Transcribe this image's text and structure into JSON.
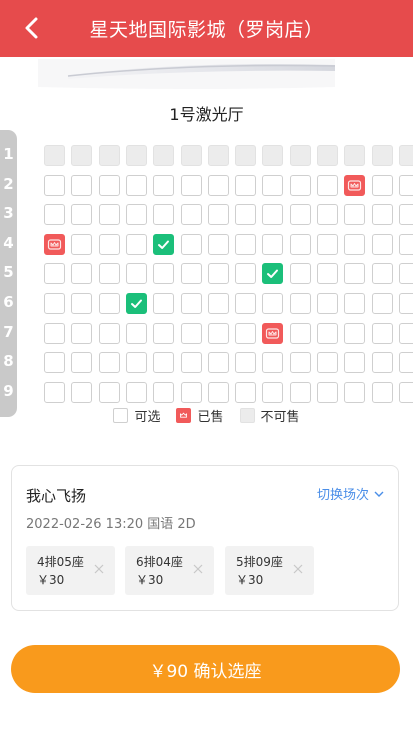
{
  "header": {
    "title": "星天地国际影城（罗岗店）",
    "back_icon": "chevron-left-icon"
  },
  "hall": {
    "name": "1号激光厅"
  },
  "rows": [
    "1",
    "2",
    "3",
    "4",
    "5",
    "6",
    "7",
    "8",
    "9"
  ],
  "seat_columns": 14,
  "disabled_rows": [
    1
  ],
  "sold_seats": [
    [
      2,
      12
    ],
    [
      4,
      1
    ],
    [
      7,
      9
    ]
  ],
  "selected_seats": [
    [
      4,
      5
    ],
    [
      5,
      9
    ],
    [
      6,
      4
    ]
  ],
  "legend": {
    "available": "可选",
    "sold": "已售",
    "unavailable": "不可售"
  },
  "selection": {
    "movie": "我心飞扬",
    "switch_label": "切换场次",
    "showtime": "2022-02-26 13:20 国语 2D",
    "tickets": [
      {
        "seat": "4排05座",
        "price": "￥30"
      },
      {
        "seat": "6排04座",
        "price": "￥30"
      },
      {
        "seat": "5排09座",
        "price": "￥30"
      }
    ]
  },
  "confirm": {
    "label": "￥90 确认选座"
  },
  "colors": {
    "header": "#e64b4c",
    "sold": "#f15a5a",
    "selected": "#1bbf7a",
    "confirm": "#f99a1c",
    "link": "#4a8ee8"
  }
}
